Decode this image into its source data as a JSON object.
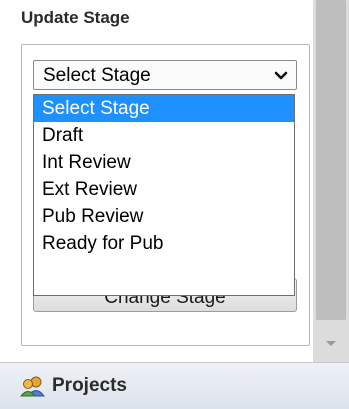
{
  "panel": {
    "title": "Update Stage",
    "stage_select": {
      "selected": "Select Stage",
      "options": [
        "Select Stage",
        "Draft",
        "Int Review",
        "Ext Review",
        "Pub Review",
        "Ready for Pub"
      ]
    },
    "change_button_label": "Change Stage"
  },
  "sidebar": {
    "projects_label": "Projects"
  },
  "icons": {
    "select_toggle": "chevron-down-icon",
    "scroll_down": "arrow-down-icon",
    "projects": "projects-people-icon"
  },
  "colors": {
    "highlight": "#1e90ff",
    "scrollbar": "#dcdcdc"
  }
}
